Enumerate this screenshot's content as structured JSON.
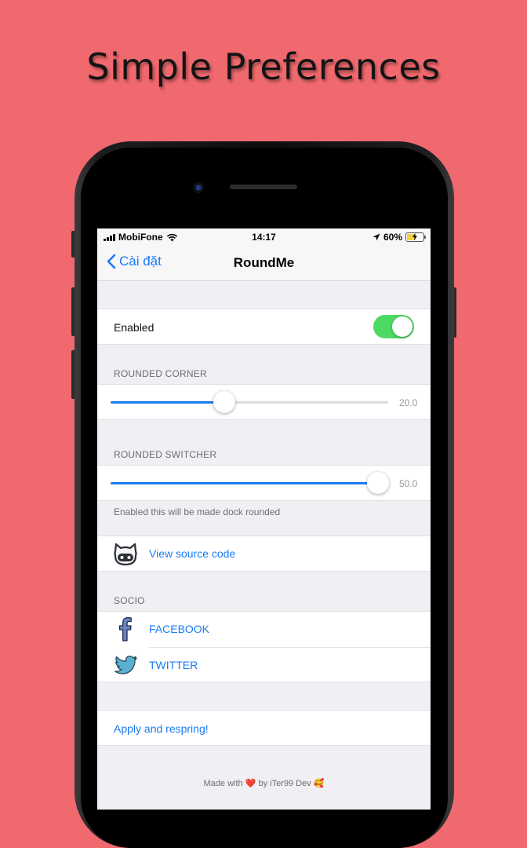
{
  "headline": "Simple Preferences",
  "colors": {
    "background": "#f0696e",
    "accent": "#1a7cf4",
    "toggle_on": "#4cd964"
  },
  "status_bar": {
    "carrier": "MobiFone",
    "time": "14:17",
    "battery": "60%",
    "battery_level": 0.6
  },
  "nav": {
    "back_label": "Cài đặt",
    "title": "RoundMe",
    "back_icon": "chevron-left-icon"
  },
  "enabled_row": {
    "label": "Enabled",
    "value": true
  },
  "rounded_corner": {
    "header": "ROUNDED CORNER",
    "value_text": "20.0",
    "fraction": 0.41
  },
  "rounded_switcher": {
    "header": "ROUNDED SWITCHER",
    "value_text": "50.0",
    "fraction": 0.964,
    "footer": "Enabled this will be made dock rounded"
  },
  "source": {
    "label": "View source code",
    "icon": "github-octocat-icon"
  },
  "socio": {
    "header": "SOCIO",
    "items": [
      {
        "label": "FACEBOOK",
        "icon": "facebook-icon"
      },
      {
        "label": "TWITTER",
        "icon": "twitter-icon"
      }
    ]
  },
  "apply": {
    "label": "Apply and respring!"
  },
  "footer": {
    "prefix": "Made with",
    "heart": "❤️",
    "by": "by iTer99 Dev",
    "emoji": "🥰"
  }
}
